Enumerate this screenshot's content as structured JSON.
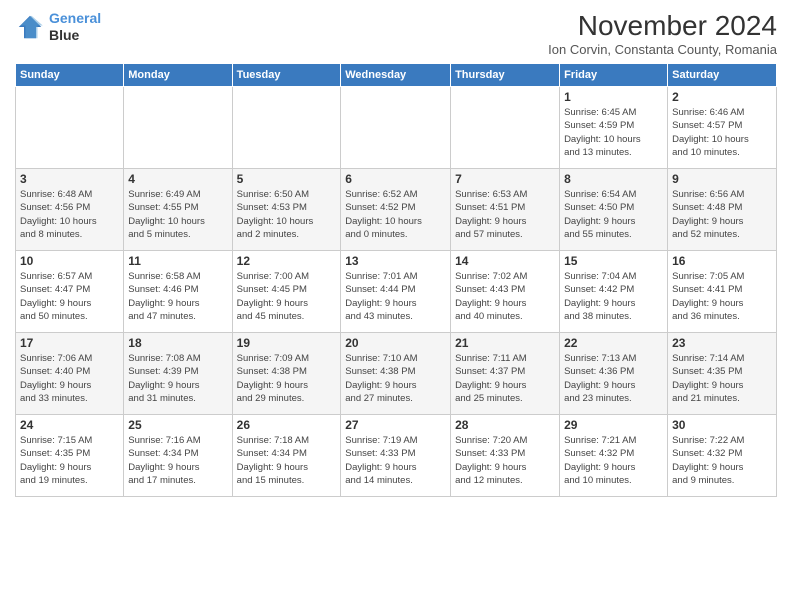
{
  "logo": {
    "line1": "General",
    "line2": "Blue"
  },
  "title": "November 2024",
  "subtitle": "Ion Corvin, Constanta County, Romania",
  "headers": [
    "Sunday",
    "Monday",
    "Tuesday",
    "Wednesday",
    "Thursday",
    "Friday",
    "Saturday"
  ],
  "weeks": [
    [
      {
        "day": "",
        "info": ""
      },
      {
        "day": "",
        "info": ""
      },
      {
        "day": "",
        "info": ""
      },
      {
        "day": "",
        "info": ""
      },
      {
        "day": "",
        "info": ""
      },
      {
        "day": "1",
        "info": "Sunrise: 6:45 AM\nSunset: 4:59 PM\nDaylight: 10 hours\nand 13 minutes."
      },
      {
        "day": "2",
        "info": "Sunrise: 6:46 AM\nSunset: 4:57 PM\nDaylight: 10 hours\nand 10 minutes."
      }
    ],
    [
      {
        "day": "3",
        "info": "Sunrise: 6:48 AM\nSunset: 4:56 PM\nDaylight: 10 hours\nand 8 minutes."
      },
      {
        "day": "4",
        "info": "Sunrise: 6:49 AM\nSunset: 4:55 PM\nDaylight: 10 hours\nand 5 minutes."
      },
      {
        "day": "5",
        "info": "Sunrise: 6:50 AM\nSunset: 4:53 PM\nDaylight: 10 hours\nand 2 minutes."
      },
      {
        "day": "6",
        "info": "Sunrise: 6:52 AM\nSunset: 4:52 PM\nDaylight: 10 hours\nand 0 minutes."
      },
      {
        "day": "7",
        "info": "Sunrise: 6:53 AM\nSunset: 4:51 PM\nDaylight: 9 hours\nand 57 minutes."
      },
      {
        "day": "8",
        "info": "Sunrise: 6:54 AM\nSunset: 4:50 PM\nDaylight: 9 hours\nand 55 minutes."
      },
      {
        "day": "9",
        "info": "Sunrise: 6:56 AM\nSunset: 4:48 PM\nDaylight: 9 hours\nand 52 minutes."
      }
    ],
    [
      {
        "day": "10",
        "info": "Sunrise: 6:57 AM\nSunset: 4:47 PM\nDaylight: 9 hours\nand 50 minutes."
      },
      {
        "day": "11",
        "info": "Sunrise: 6:58 AM\nSunset: 4:46 PM\nDaylight: 9 hours\nand 47 minutes."
      },
      {
        "day": "12",
        "info": "Sunrise: 7:00 AM\nSunset: 4:45 PM\nDaylight: 9 hours\nand 45 minutes."
      },
      {
        "day": "13",
        "info": "Sunrise: 7:01 AM\nSunset: 4:44 PM\nDaylight: 9 hours\nand 43 minutes."
      },
      {
        "day": "14",
        "info": "Sunrise: 7:02 AM\nSunset: 4:43 PM\nDaylight: 9 hours\nand 40 minutes."
      },
      {
        "day": "15",
        "info": "Sunrise: 7:04 AM\nSunset: 4:42 PM\nDaylight: 9 hours\nand 38 minutes."
      },
      {
        "day": "16",
        "info": "Sunrise: 7:05 AM\nSunset: 4:41 PM\nDaylight: 9 hours\nand 36 minutes."
      }
    ],
    [
      {
        "day": "17",
        "info": "Sunrise: 7:06 AM\nSunset: 4:40 PM\nDaylight: 9 hours\nand 33 minutes."
      },
      {
        "day": "18",
        "info": "Sunrise: 7:08 AM\nSunset: 4:39 PM\nDaylight: 9 hours\nand 31 minutes."
      },
      {
        "day": "19",
        "info": "Sunrise: 7:09 AM\nSunset: 4:38 PM\nDaylight: 9 hours\nand 29 minutes."
      },
      {
        "day": "20",
        "info": "Sunrise: 7:10 AM\nSunset: 4:38 PM\nDaylight: 9 hours\nand 27 minutes."
      },
      {
        "day": "21",
        "info": "Sunrise: 7:11 AM\nSunset: 4:37 PM\nDaylight: 9 hours\nand 25 minutes."
      },
      {
        "day": "22",
        "info": "Sunrise: 7:13 AM\nSunset: 4:36 PM\nDaylight: 9 hours\nand 23 minutes."
      },
      {
        "day": "23",
        "info": "Sunrise: 7:14 AM\nSunset: 4:35 PM\nDaylight: 9 hours\nand 21 minutes."
      }
    ],
    [
      {
        "day": "24",
        "info": "Sunrise: 7:15 AM\nSunset: 4:35 PM\nDaylight: 9 hours\nand 19 minutes."
      },
      {
        "day": "25",
        "info": "Sunrise: 7:16 AM\nSunset: 4:34 PM\nDaylight: 9 hours\nand 17 minutes."
      },
      {
        "day": "26",
        "info": "Sunrise: 7:18 AM\nSunset: 4:34 PM\nDaylight: 9 hours\nand 15 minutes."
      },
      {
        "day": "27",
        "info": "Sunrise: 7:19 AM\nSunset: 4:33 PM\nDaylight: 9 hours\nand 14 minutes."
      },
      {
        "day": "28",
        "info": "Sunrise: 7:20 AM\nSunset: 4:33 PM\nDaylight: 9 hours\nand 12 minutes."
      },
      {
        "day": "29",
        "info": "Sunrise: 7:21 AM\nSunset: 4:32 PM\nDaylight: 9 hours\nand 10 minutes."
      },
      {
        "day": "30",
        "info": "Sunrise: 7:22 AM\nSunset: 4:32 PM\nDaylight: 9 hours\nand 9 minutes."
      }
    ]
  ]
}
